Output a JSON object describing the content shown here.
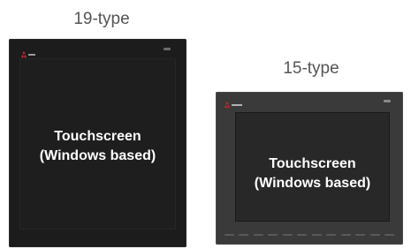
{
  "products": [
    {
      "caption": "19-type",
      "screen_line1": "Touchscreen",
      "screen_line2": "(Windows based)",
      "logo_icon": "mitsubishi-logo-icon"
    },
    {
      "caption": "15-type",
      "screen_line1": "Touchscreen",
      "screen_line2": "(Windows based)",
      "logo_icon": "mitsubishi-logo-icon",
      "function_key_count": 12
    }
  ],
  "colors": {
    "caption": "#555555",
    "panel_19": "#1c1c1c",
    "panel_15": "#3a3a3a",
    "label": "#ffffff"
  }
}
